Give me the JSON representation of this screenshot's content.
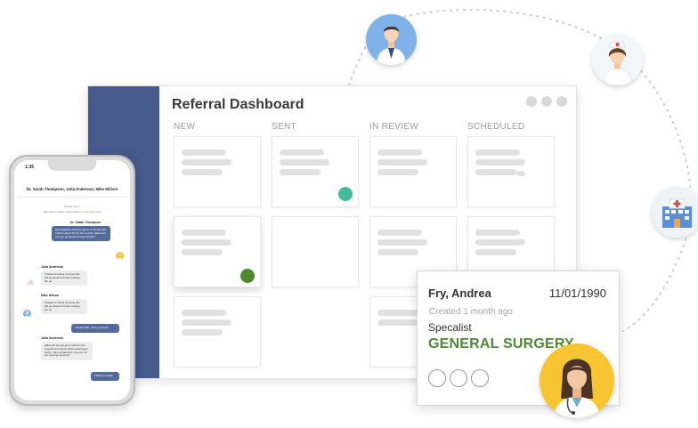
{
  "dashboard": {
    "title": "Referral Dashboard",
    "columns": [
      "NEW",
      "SENT",
      "IN REVIEW",
      "SCHEDULED"
    ]
  },
  "referral_card": {
    "name": "Fry, Andrea",
    "dob": "11/01/1990",
    "created": "Created 1 month ago",
    "role": "Specalist",
    "specialty": "GENERAL SURGERY"
  },
  "phone": {
    "time": "1:35",
    "chat_title": "Dr. Sarah Thompson, Julia Anderson, Mike Wilson",
    "date_pill": "Monday Dec 4",
    "system_note": "Mike Wilson added Julia Anderson to the group chat",
    "messages": [
      {
        "sender": "Dr. Sarah Thompson",
        "text": "My daughters school program is running late. I will be about 30 min late to clinic. @Everett can you go ahead and get started?"
      },
      {
        "sender": "Julia Anderson",
        "text": "Thanks for letting us know. We will go ahead and start working the up."
      },
      {
        "sender": "Mike  Wilson",
        "text": "Thanks for letting us know. We will go ahead and start working the up."
      },
      {
        "sender": "",
        "text": "Thanks Mike, I'll let you know."
      },
      {
        "sender": "Julia Anderson",
        "text": "@Everett we just got a call from the hospital and Janice will be discharged today. I have worked him into your 10 am opening tomorrow."
      },
      {
        "sender": "",
        "text": "Thank you sister"
      }
    ]
  },
  "colors": {
    "sidebar": "#465a8c",
    "status_teal": "#44bc9c",
    "status_green": "#4d8a2f",
    "specialty_green": "#4e8a34",
    "outgoing_bubble": "#556a9c"
  },
  "icons": [
    "doctor-male-avatar",
    "nurse-avatar",
    "hospital-icon",
    "doctor-female-avatar"
  ]
}
